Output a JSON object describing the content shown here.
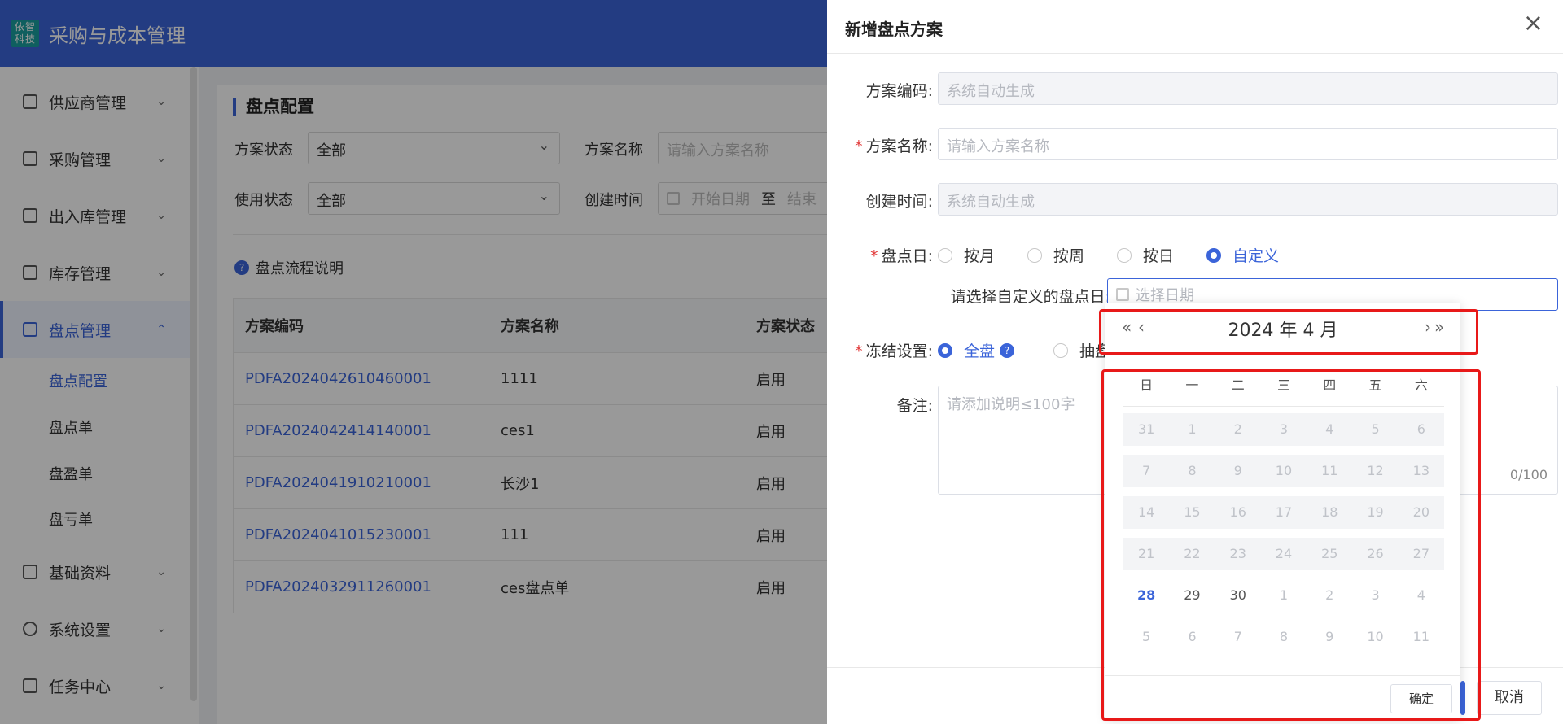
{
  "app": {
    "logo_text": "依智科技",
    "title": "采购与成本管理"
  },
  "sidebar": {
    "items": [
      {
        "label": "供应商管理"
      },
      {
        "label": "采购管理"
      },
      {
        "label": "出入库管理"
      },
      {
        "label": "库存管理"
      },
      {
        "label": "盘点管理"
      },
      {
        "label": "基础资料"
      },
      {
        "label": "系统设置"
      },
      {
        "label": "任务中心"
      }
    ],
    "subitems": [
      {
        "label": "盘点配置"
      },
      {
        "label": "盘点单"
      },
      {
        "label": "盘盈单"
      },
      {
        "label": "盘亏单"
      }
    ]
  },
  "main": {
    "title": "盘点配置",
    "filters": {
      "status_label": "方案状态",
      "status_value": "全部",
      "name_label": "方案名称",
      "name_placeholder": "请输入方案名称",
      "use_label": "使用状态",
      "use_value": "全部",
      "created_label": "创建时间",
      "start_placeholder": "开始日期",
      "to": "至",
      "end_placeholder": "结束"
    },
    "help_text": "盘点流程说明",
    "table": {
      "headers": [
        "方案编码",
        "方案名称",
        "方案状态"
      ],
      "rows": [
        [
          "PDFA2024042610460001",
          "1111",
          "启用"
        ],
        [
          "PDFA2024042414140001",
          "ces1",
          "启用"
        ],
        [
          "PDFA2024041910210001",
          "长沙1",
          "启用"
        ],
        [
          "PDFA2024041015230001",
          "111",
          "启用"
        ],
        [
          "PDFA2024032911260001",
          "ces盘点单",
          "启用"
        ]
      ]
    }
  },
  "drawer": {
    "title": "新增盘点方案",
    "code_label": "方案编码:",
    "code_value": "系统自动生成",
    "name_label": "方案名称:",
    "name_placeholder": "请输入方案名称",
    "created_label": "创建时间:",
    "created_value": "系统自动生成",
    "day_label": "盘点日:",
    "day_options": [
      "按月",
      "按周",
      "按日",
      "自定义"
    ],
    "custom_label": "请选择自定义的盘点日:",
    "date_placeholder": "选择日期",
    "freeze_label": "冻结设置:",
    "freeze_options": [
      "全盘",
      "抽盘"
    ],
    "remark_label": "备注:",
    "remark_placeholder": "请添加说明≤100字",
    "remark_counter": "0/100",
    "cancel": "取消"
  },
  "datepicker": {
    "prev_year": "«",
    "prev_month": "‹",
    "next_month": "›",
    "next_year": "»",
    "title": "2024 年  4 月",
    "weekdays": [
      "日",
      "一",
      "二",
      "三",
      "四",
      "五",
      "六"
    ],
    "weeks": [
      [
        "31",
        "1",
        "2",
        "3",
        "4",
        "5",
        "6"
      ],
      [
        "7",
        "8",
        "9",
        "10",
        "11",
        "12",
        "13"
      ],
      [
        "14",
        "15",
        "16",
        "17",
        "18",
        "19",
        "20"
      ],
      [
        "21",
        "22",
        "23",
        "24",
        "25",
        "26",
        "27"
      ],
      [
        "28",
        "29",
        "30",
        "1",
        "2",
        "3",
        "4"
      ],
      [
        "5",
        "6",
        "7",
        "8",
        "9",
        "10",
        "11"
      ]
    ],
    "confirm": "确定"
  },
  "colors": {
    "primary": "#3b64d9",
    "highlight": "#e81919",
    "required": "#e23b3b"
  }
}
